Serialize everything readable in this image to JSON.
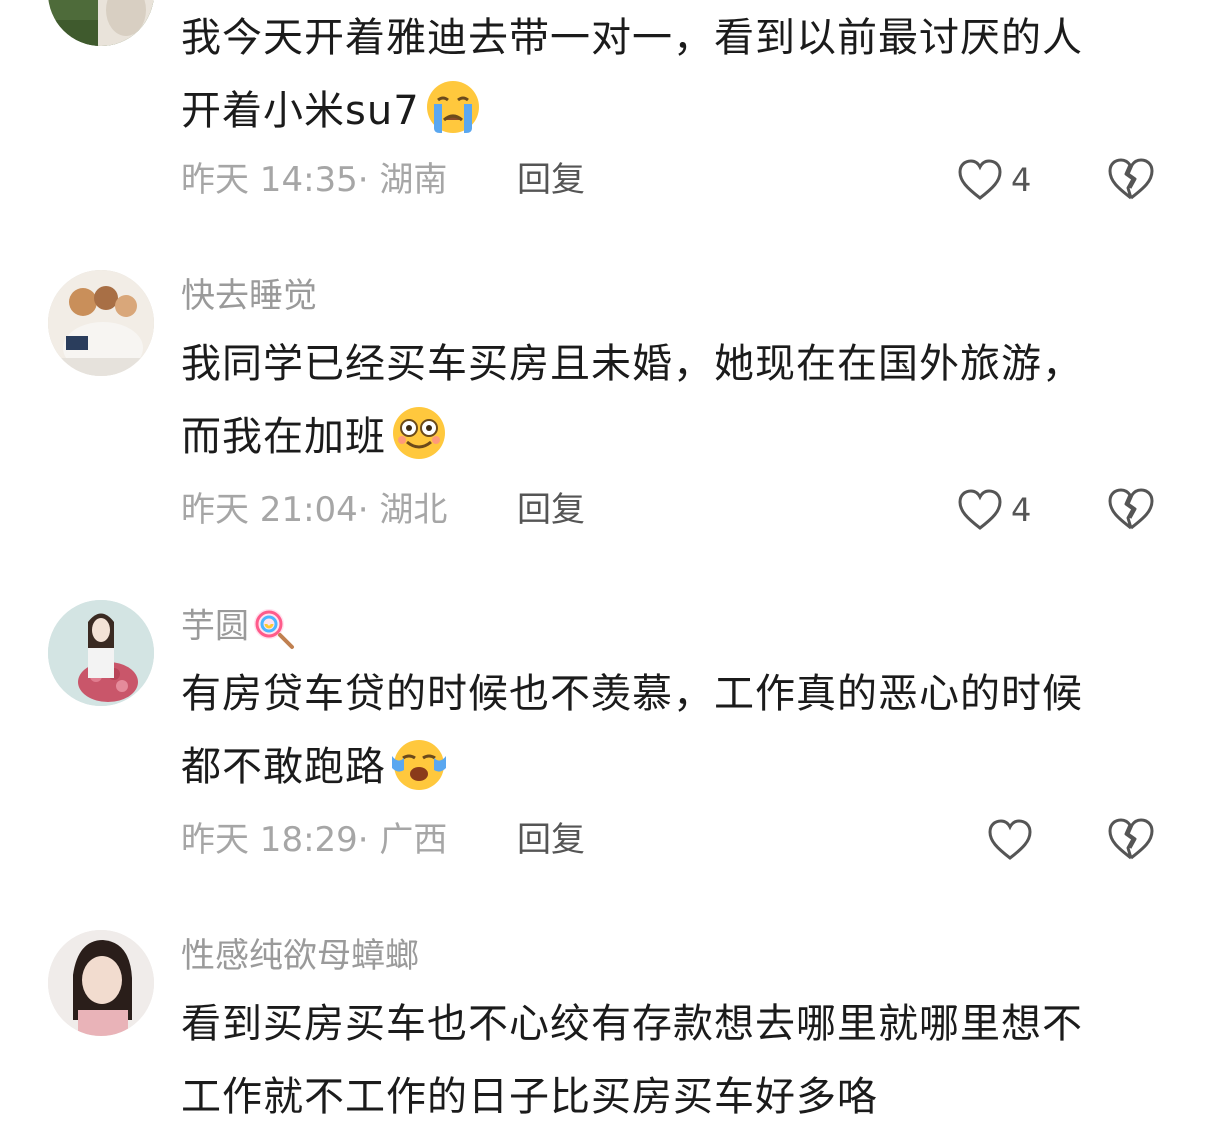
{
  "comments": [
    {
      "username": "",
      "content_lines": [
        "我今天开着雅迪去带一对一，看到以前最讨厌的人",
        "开着小米su7"
      ],
      "emoji": "crying-face",
      "time": "昨天 14:35",
      "location": "湖南",
      "meta": "昨天 14:35· 湖南",
      "reply_label": "回复",
      "likes": "4"
    },
    {
      "username": "快去睡觉",
      "content_lines": [
        "我同学已经买车买房且未婚，她现在在国外旅游，",
        "而我在加班"
      ],
      "emoji": "dizzy-smile-face",
      "time": "昨天 21:04",
      "location": "湖北",
      "meta": "昨天 21:04· 湖北",
      "reply_label": "回复",
      "likes": "4"
    },
    {
      "username": "芋圆",
      "username_emoji": "lollipop",
      "content_lines": [
        "有房贷车贷的时候也不羡慕，工作真的恶心的时候",
        "都不敢跑路"
      ],
      "emoji": "loudly-crying-face",
      "time": "昨天 18:29",
      "location": "广西",
      "meta": "昨天 18:29· 广西",
      "reply_label": "回复",
      "likes": ""
    },
    {
      "username": "性感纯欲母蟑螂",
      "content_lines": [
        "看到买房买车也不心绞有存款想去哪里就哪里想不",
        "工作就不工作的日子比买房买车好多咯"
      ]
    }
  ],
  "colors": {
    "username": "#9a9a9a",
    "content": "#1b1b1b",
    "meta": "#a6a6a6",
    "icon": "#555555"
  }
}
